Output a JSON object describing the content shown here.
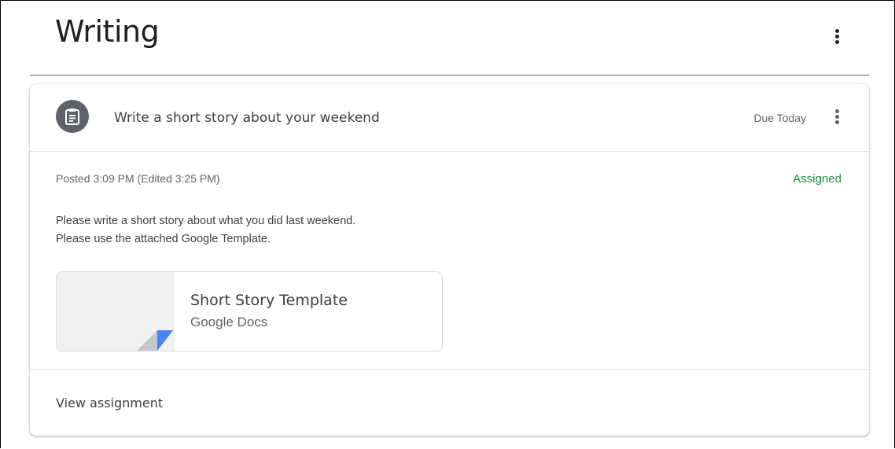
{
  "topic": {
    "title": "Writing"
  },
  "assignment": {
    "icon": "assignment-icon",
    "title": "Write a short story about your weekend",
    "due": "Due Today",
    "posted": "Posted 3:09 PM (Edited 3:25 PM)",
    "status": "Assigned",
    "status_color": "#1e8e3e",
    "description_lines": [
      "Please write a short story about what you did last weekend.",
      "Please use the attached Google Template."
    ],
    "attachment": {
      "title": "Short Story Template",
      "type": "Google Docs",
      "accent_color": "#4285f4"
    },
    "view_link": "View assignment"
  }
}
